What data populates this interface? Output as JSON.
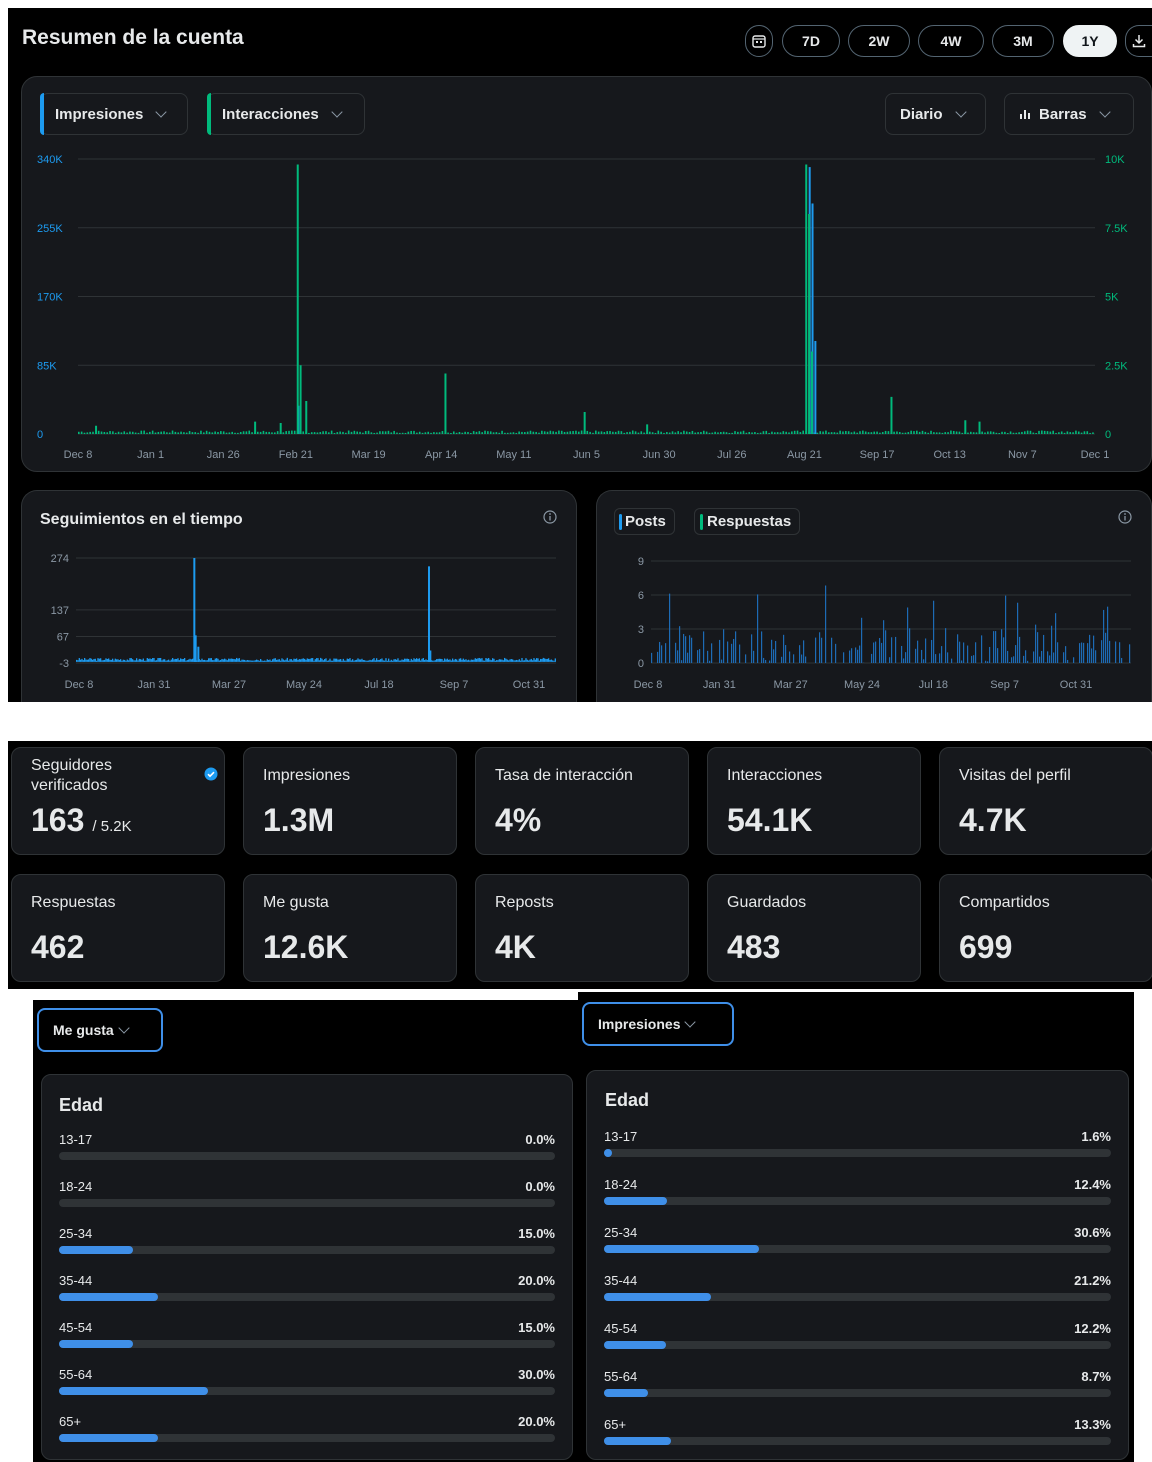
{
  "header": {
    "title": "Resumen de la cuenta",
    "ranges": [
      "7D",
      "2W",
      "4W",
      "3M",
      "1Y"
    ],
    "selected_range": "1Y"
  },
  "main_chart": {
    "metric_left": "Impresiones",
    "metric_right": "Interacciones",
    "granularity": "Diario",
    "chart_style": "Barras",
    "left_color": "#1d9bf0",
    "right_color": "#00ba7c",
    "chart_data": {
      "type": "bar",
      "x_ticks": [
        "Dec 8",
        "Jan 1",
        "Jan 26",
        "Feb 21",
        "Mar 19",
        "Apr 14",
        "May 11",
        "Jun 5",
        "Jun 30",
        "Jul 26",
        "Aug 21",
        "Sep 17",
        "Oct 13",
        "Nov 7",
        "Dec 1"
      ],
      "y_left_ticks": [
        "340K",
        "255K",
        "170K",
        "85K",
        "0"
      ],
      "y_left_lim": [
        0,
        340000
      ],
      "y_right_ticks": [
        "10K",
        "7.5K",
        "5K",
        "2.5K",
        "0"
      ],
      "y_right_lim": [
        0,
        10000
      ],
      "impresiones_peaks": [
        {
          "x": "Aug 21",
          "y": 330000
        },
        {
          "x": "Aug 22",
          "y": 285000
        },
        {
          "x": "Aug 23",
          "y": 115000
        },
        {
          "x": "Feb 23",
          "y": 35000
        }
      ],
      "interacciones_peaks": [
        {
          "x": "Dec 14",
          "y": 300
        },
        {
          "x": "Feb 8",
          "y": 450
        },
        {
          "x": "Feb 17",
          "y": 400
        },
        {
          "x": "Feb 23",
          "y": 9800
        },
        {
          "x": "Feb 24",
          "y": 2500
        },
        {
          "x": "Feb 26",
          "y": 1200
        },
        {
          "x": "Apr 15",
          "y": 2200
        },
        {
          "x": "Jun 3",
          "y": 800
        },
        {
          "x": "Jun 25",
          "y": 350
        },
        {
          "x": "Aug 20",
          "y": 9800
        },
        {
          "x": "Aug 21",
          "y": 8000
        },
        {
          "x": "Aug 22",
          "y": 3000
        },
        {
          "x": "Sep 19",
          "y": 1350
        },
        {
          "x": "Oct 15",
          "y": 500
        },
        {
          "x": "Oct 20",
          "y": 450
        }
      ]
    }
  },
  "follows_chart": {
    "title": "Seguimientos en el tiempo",
    "info_icon": "info-icon",
    "chart_data": {
      "type": "bar",
      "y_ticks": [
        "274",
        "137",
        "67",
        "-3"
      ],
      "y_lim": [
        -3,
        274
      ],
      "x_ticks": [
        "Dec 8",
        "Jan 31",
        "Mar 27",
        "May 24",
        "Jul 18",
        "Sep 7",
        "Oct 31"
      ],
      "peaks": [
        {
          "x": "Mar 5",
          "y": 274
        },
        {
          "x": "Mar 6",
          "y": 70
        },
        {
          "x": "Mar 8",
          "y": 40
        },
        {
          "x": "Aug 28",
          "y": 252
        },
        {
          "x": "Aug 29",
          "y": 30
        }
      ]
    }
  },
  "posts_chart": {
    "legend": [
      "Posts",
      "Respuestas"
    ],
    "legend_colors": [
      "#1d9bf0",
      "#00ba7c"
    ],
    "chart_data": {
      "type": "bar",
      "y_ticks": [
        "9",
        "6",
        "3",
        "0"
      ],
      "y_lim": [
        0,
        9
      ],
      "x_ticks": [
        "Dec 8",
        "Jan 31",
        "Mar 27",
        "May 24",
        "Jul 18",
        "Sep 7",
        "Oct 31"
      ]
    }
  },
  "stats": [
    {
      "label": "Seguidores verificados",
      "value": "163",
      "suffix": "/ 5.2K"
    },
    {
      "label": "Impresiones",
      "value": "1.3M"
    },
    {
      "label": "Tasa de interacción",
      "value": "4%"
    },
    {
      "label": "Interacciones",
      "value": "54.1K"
    },
    {
      "label": "Visitas del perfil",
      "value": "4.7K"
    },
    {
      "label": "Respuestas",
      "value": "462"
    },
    {
      "label": "Me gusta",
      "value": "12.6K"
    },
    {
      "label": "Reposts",
      "value": "4K"
    },
    {
      "label": "Guardados",
      "value": "483"
    },
    {
      "label": "Compartidos",
      "value": "699"
    }
  ],
  "age_left": {
    "dropdown": "Me gusta",
    "title": "Edad",
    "rows": [
      {
        "label": "13-17",
        "value": "0.0%",
        "pct": 0
      },
      {
        "label": "18-24",
        "value": "0.0%",
        "pct": 0
      },
      {
        "label": "25-34",
        "value": "15.0%",
        "pct": 15
      },
      {
        "label": "35-44",
        "value": "20.0%",
        "pct": 20
      },
      {
        "label": "45-54",
        "value": "15.0%",
        "pct": 15
      },
      {
        "label": "55-64",
        "value": "30.0%",
        "pct": 30
      },
      {
        "label": "65+",
        "value": "20.0%",
        "pct": 20
      }
    ]
  },
  "age_right": {
    "dropdown": "Impresiones",
    "title": "Edad",
    "rows": [
      {
        "label": "13-17",
        "value": "1.6%",
        "pct": 1.6
      },
      {
        "label": "18-24",
        "value": "12.4%",
        "pct": 12.4
      },
      {
        "label": "25-34",
        "value": "30.6%",
        "pct": 30.6
      },
      {
        "label": "35-44",
        "value": "21.2%",
        "pct": 21.2
      },
      {
        "label": "45-54",
        "value": "12.2%",
        "pct": 12.2
      },
      {
        "label": "55-64",
        "value": "8.7%",
        "pct": 8.7
      },
      {
        "label": "65+",
        "value": "13.3%",
        "pct": 13.3
      }
    ]
  }
}
